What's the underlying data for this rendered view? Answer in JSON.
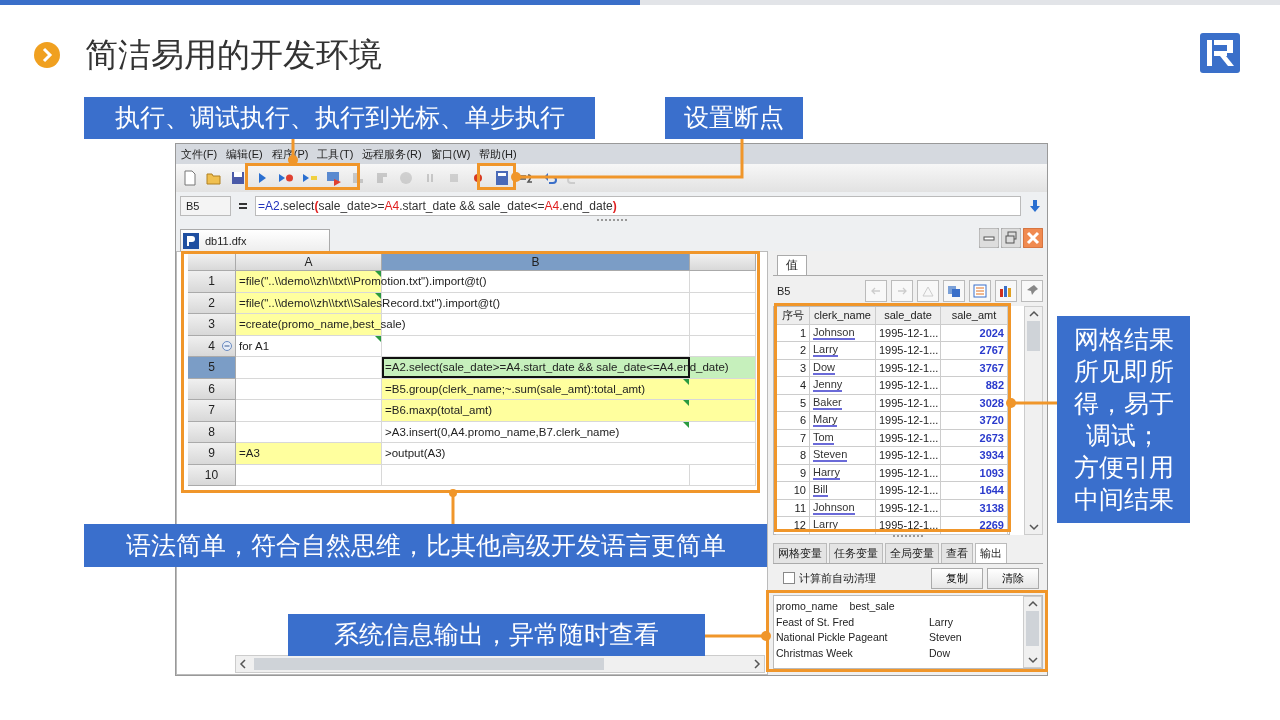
{
  "slide": {
    "title": "简洁易用的开发环境"
  },
  "callouts": [
    {
      "lines": [
        "执行、调试执行、执行到光标、单步执行"
      ]
    },
    {
      "lines": [
        "设置断点"
      ]
    },
    {
      "lines": [
        "网格结果",
        "所见即所",
        "得，易于",
        "调试；",
        "方便引用",
        "中间结果"
      ]
    },
    {
      "lines": [
        "语法简单，符合自然思维，比其他高级开发语言更简单"
      ]
    },
    {
      "lines": [
        "系统信息输出，异常随时查看"
      ]
    }
  ],
  "app": {
    "menu": [
      "文件(F)",
      "编辑(E)",
      "程序(P)",
      "工具(T)",
      "远程服务(R)",
      "窗口(W)",
      "帮助(H)"
    ],
    "toolbar": [
      {
        "kind": "new",
        "disabled": false
      },
      {
        "kind": "open",
        "disabled": false
      },
      {
        "kind": "save",
        "disabled": false
      },
      {
        "kind": "run",
        "disabled": false
      },
      {
        "kind": "debug",
        "disabled": false
      },
      {
        "kind": "run-to-cursor",
        "disabled": false
      },
      {
        "kind": "step",
        "disabled": false
      },
      {
        "kind": "step-into",
        "disabled": true
      },
      {
        "kind": "step-out",
        "disabled": true
      },
      {
        "kind": "stop-circle",
        "disabled": true
      },
      {
        "kind": "pause",
        "disabled": true
      },
      {
        "kind": "stop",
        "disabled": true
      },
      {
        "kind": "breakpoint",
        "disabled": false
      },
      {
        "kind": "calculate",
        "disabled": false
      },
      {
        "kind": "evaluate",
        "disabled": false
      },
      {
        "kind": "undo",
        "disabled": false
      },
      {
        "kind": "redo",
        "disabled": true
      }
    ],
    "cell_ref": "B5",
    "formula": [
      {
        "text": "=",
        "color": "#2233bb",
        "bold": false
      },
      {
        "text": "A2",
        "color": "#2233bb",
        "bold": false
      },
      {
        "text": ".select",
        "color": "#333333",
        "bold": false
      },
      {
        "text": "(",
        "color": "#e02020",
        "bold": true
      },
      {
        "text": "sale_date>=",
        "color": "#333333",
        "bold": false
      },
      {
        "text": "A4",
        "color": "#e02020",
        "bold": false
      },
      {
        "text": ".start_date && sale_date<=",
        "color": "#333333",
        "bold": false
      },
      {
        "text": "A4",
        "color": "#e02020",
        "bold": false
      },
      {
        "text": ".end_date",
        "color": "#333333",
        "bold": false
      },
      {
        "text": ")",
        "color": "#e02020",
        "bold": true
      }
    ],
    "doc_tab": "db11.dfx",
    "grid": {
      "columns": [
        {
          "label": "A",
          "selected": false
        },
        {
          "label": "B",
          "selected": true
        }
      ],
      "rows": [
        {
          "number": "1",
          "selected": false,
          "kind": "plain",
          "cells": [
            {
              "text": "=file(\"..\\\\demo\\\\zh\\\\txt\\\\Promotion.txt\").import@t()",
              "highlighted": true,
              "selected": false,
              "marked": true
            },
            {
              "highlighted": false,
              "selected": false,
              "marked": false
            }
          ]
        },
        {
          "number": "2",
          "selected": false,
          "kind": "plain",
          "cells": [
            {
              "text": "=file(\"..\\\\demo\\\\zh\\\\txt\\\\SalesRecord.txt\").import@t()",
              "highlighted": true,
              "selected": false,
              "marked": true
            },
            {
              "highlighted": false,
              "selected": false,
              "marked": false
            }
          ]
        },
        {
          "number": "3",
          "selected": false,
          "kind": "plain",
          "cells": [
            {
              "text": "=create(promo_name,best_sale)",
              "highlighted": true,
              "selected": false,
              "marked": false
            },
            {
              "highlighted": false,
              "selected": false,
              "marked": false
            }
          ]
        },
        {
          "number": "4",
          "selected": false,
          "kind": "loop",
          "cells": [
            {
              "text": "for A1",
              "highlighted": false,
              "selected": false,
              "marked": true
            },
            {
              "highlighted": false,
              "selected": false,
              "marked": false
            }
          ]
        },
        {
          "number": "5",
          "selected": true,
          "kind": "plain",
          "cells": [
            {
              "highlighted": false,
              "selected": false,
              "marked": false
            },
            {
              "text": "=A2.select(sale_date>=A4.start_date && sale_date<=A4.end_date)",
              "highlighted": false,
              "selected": true,
              "marked": false
            }
          ]
        },
        {
          "number": "6",
          "selected": false,
          "kind": "plain",
          "cells": [
            {
              "highlighted": false,
              "selected": false,
              "marked": false
            },
            {
              "text": "=B5.group(clerk_name;~.sum(sale_amt):total_amt)",
              "highlighted": true,
              "selected": false,
              "marked": true
            }
          ]
        },
        {
          "number": "7",
          "selected": false,
          "kind": "plain",
          "cells": [
            {
              "highlighted": false,
              "selected": false,
              "marked": false
            },
            {
              "text": "=B6.maxp(total_amt)",
              "highlighted": true,
              "selected": false,
              "marked": true
            }
          ]
        },
        {
          "number": "8",
          "selected": false,
          "kind": "plain",
          "cells": [
            {
              "highlighted": false,
              "selected": false,
              "marked": false
            },
            {
              "text": ">A3.insert(0,A4.promo_name,B7.clerk_name)",
              "highlighted": false,
              "selected": false,
              "marked": true
            }
          ]
        },
        {
          "number": "9",
          "selected": false,
          "kind": "plain",
          "cells": [
            {
              "text": "=A3",
              "highlighted": true,
              "selected": false,
              "marked": false
            },
            {
              "text": ">output(A3)",
              "highlighted": false,
              "selected": false,
              "marked": false
            }
          ]
        },
        {
          "number": "10",
          "selected": false,
          "kind": "plain",
          "cells": [
            {
              "highlighted": false,
              "selected": false,
              "marked": false
            },
            {
              "highlighted": false,
              "selected": false,
              "marked": false
            }
          ]
        }
      ]
    },
    "panel": {
      "tab": "值",
      "cell_ref": "B5",
      "toolbar": [
        {
          "kind": "back",
          "disabled": true
        },
        {
          "kind": "forward",
          "disabled": true
        },
        {
          "kind": "locate",
          "disabled": true
        },
        {
          "kind": "copy",
          "disabled": false
        },
        {
          "kind": "list",
          "disabled": false
        },
        {
          "kind": "chart",
          "disabled": false
        },
        {
          "kind": "pin",
          "disabled": false
        }
      ],
      "table": {
        "columns": [
          "序号",
          "clerk_name",
          "sale_date",
          "sale_amt"
        ],
        "rows": [
          [
            "1",
            "Johnson",
            "1995-12-1...",
            "2024"
          ],
          [
            "2",
            "Larry",
            "1995-12-1...",
            "2767"
          ],
          [
            "3",
            "Dow",
            "1995-12-1...",
            "3767"
          ],
          [
            "4",
            "Jenny",
            "1995-12-1...",
            "882"
          ],
          [
            "5",
            "Baker",
            "1995-12-1...",
            "3028"
          ],
          [
            "6",
            "Mary",
            "1995-12-1...",
            "3720"
          ],
          [
            "7",
            "Tom",
            "1995-12-1...",
            "2673"
          ],
          [
            "8",
            "Steven",
            "1995-12-1...",
            "3934"
          ],
          [
            "9",
            "Harry",
            "1995-12-1...",
            "1093"
          ],
          [
            "10",
            "Bill",
            "1995-12-1...",
            "1644"
          ],
          [
            "11",
            "Johnson",
            "1995-12-1...",
            "3138"
          ],
          [
            "12",
            "Larry",
            "1995-12-1...",
            "2269"
          ]
        ]
      },
      "bottom_tabs": [
        {
          "label": "网格变量",
          "selected": false
        },
        {
          "label": "任务变量",
          "selected": false
        },
        {
          "label": "全局变量",
          "selected": false
        },
        {
          "label": "查看",
          "selected": false
        },
        {
          "label": "输出",
          "selected": true
        }
      ],
      "auto_clear": {
        "label": "计算前自动清理",
        "checked": false
      },
      "buttons": [
        "复制",
        "清除"
      ],
      "output": {
        "header": [
          "promo_name",
          "best_sale"
        ],
        "rows": [
          [
            "Feast of St. Fred",
            "Larry"
          ],
          [
            "National Pickle Pageant",
            "Steven"
          ],
          [
            "Christmas Week",
            "Dow"
          ]
        ]
      }
    }
  }
}
